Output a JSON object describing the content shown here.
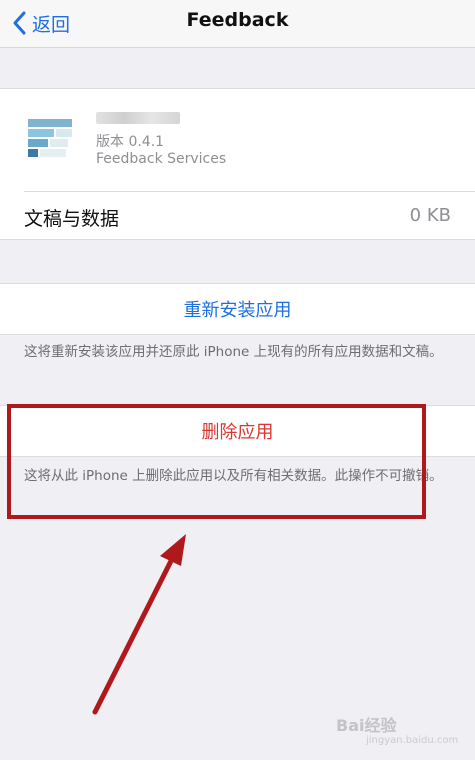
{
  "navbar": {
    "back_label": "返回",
    "title": "Feedback",
    "accent_color": "#1f6fe0"
  },
  "app_info": {
    "version": "版本 0.4.1",
    "vendor": "Feedback Services"
  },
  "documents_row": {
    "label": "文稿与数据",
    "value": "0 KB"
  },
  "reinstall": {
    "label": "重新安装应用",
    "footnote": "这将重新安装该应用并还原此 iPhone 上现有的所有应用数据和文稿。"
  },
  "delete": {
    "label": "删除应用",
    "footnote": "这将从此 iPhone 上删除此应用以及所有相关数据。此操作不可撤销。",
    "color": "#d9372f"
  },
  "annotation": {
    "box_color": "#b0191c",
    "arrow_color": "#b0191c"
  },
  "watermark": {
    "text": "Bai经验",
    "sub": "jingyan.baidu.com"
  }
}
